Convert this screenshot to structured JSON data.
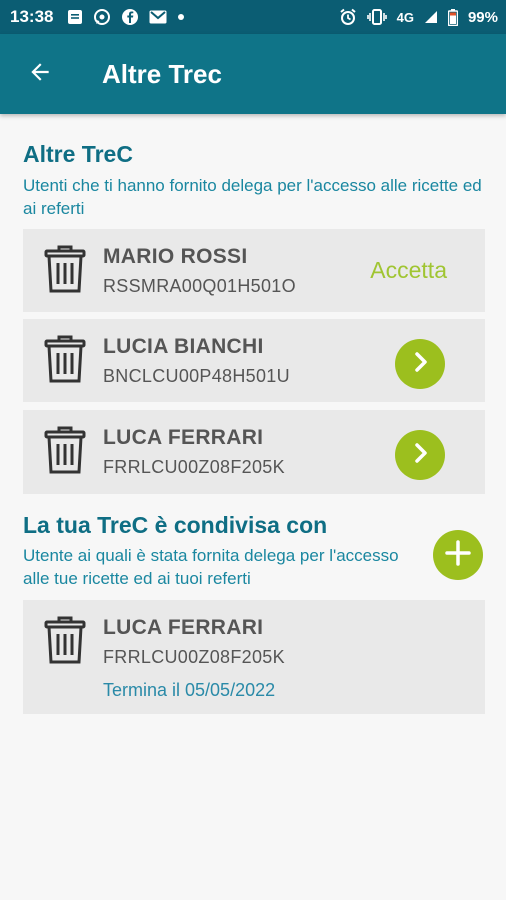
{
  "status_bar": {
    "time": "13:38",
    "network": "4G",
    "battery": "99%",
    "icons": [
      "message-icon",
      "whatsapp-icon",
      "facebook-icon",
      "gmail-icon",
      "notification-dot-icon",
      "alarm-icon",
      "vibrate-icon",
      "signal-icon",
      "battery-icon"
    ]
  },
  "app_bar": {
    "title": "Altre Trec",
    "back_icon": "arrow-back-icon"
  },
  "other_trec": {
    "title": "Altre TreC",
    "description": "Utenti che ti hanno fornito delega per l'accesso alle ricette ed ai referti",
    "items": [
      {
        "name": "MARIO ROSSI",
        "code": "RSSMRA00Q01H501O",
        "action_label": "Accetta"
      },
      {
        "name": "LUCIA BIANCHI",
        "code": "BNCLCU00P48H501U"
      },
      {
        "name": "LUCA FERRARI",
        "code": "FRRLCU00Z08F205K"
      }
    ]
  },
  "shared_with": {
    "title": "La tua TreC è condivisa con",
    "description": "Utente ai quali è stata fornita delega per l'accesso alle tue ricette ed ai tuoi referti",
    "items": [
      {
        "name": "LUCA FERRARI",
        "code": "FRRLCU00Z08F205K",
        "expiry": "Termina il 05/05/2022"
      }
    ]
  },
  "colors": {
    "status_bar": "#0b5d73",
    "app_bar": "#0f7488",
    "accent_green": "#9cbf1e",
    "title_teal": "#0f6e84",
    "card_bg": "#e9e9e9"
  }
}
